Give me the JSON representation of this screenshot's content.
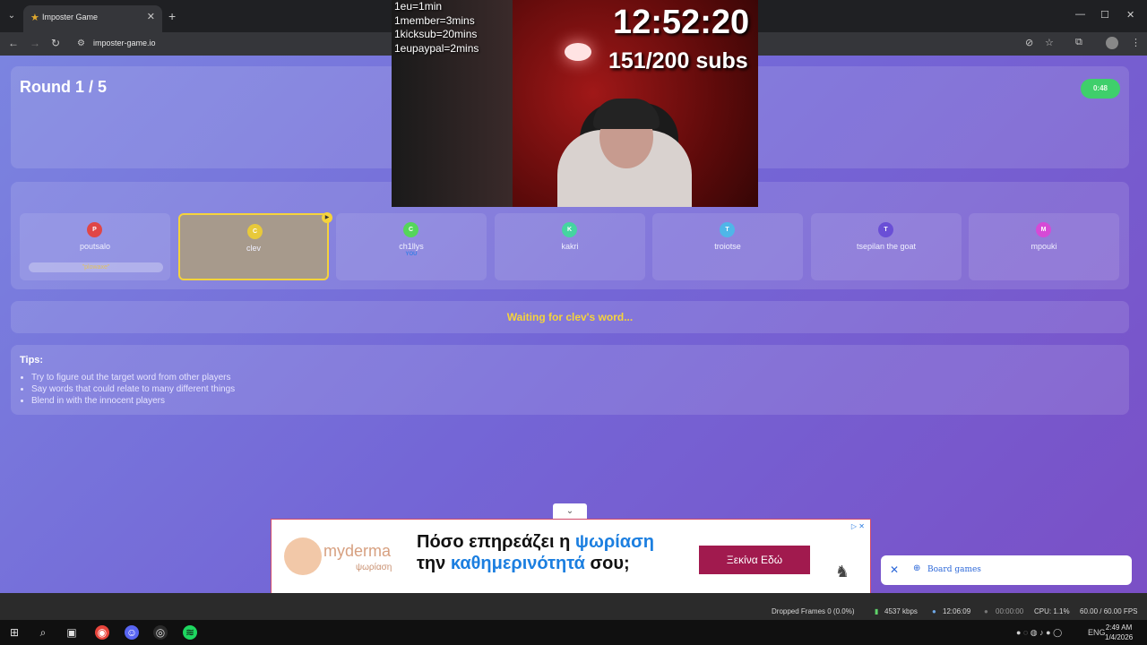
{
  "browser": {
    "tab_title": "Imposter Game",
    "url": "imposter-game.io"
  },
  "game": {
    "round": "Round 1 / 5",
    "timer": "0:48",
    "players": [
      {
        "initial": "P",
        "name": "poutsalo",
        "color": "#e04646",
        "word": "\"plowaxe\"",
        "you": "",
        "active": false
      },
      {
        "initial": "C",
        "name": "clev",
        "color": "#e8c93a",
        "word": "",
        "you": "",
        "active": true
      },
      {
        "initial": "C",
        "name": "ch1llys",
        "color": "#55d65a",
        "word": "",
        "you": "YOU",
        "active": false
      },
      {
        "initial": "K",
        "name": "kakri",
        "color": "#45d4a0",
        "word": "",
        "you": "",
        "active": false
      },
      {
        "initial": "T",
        "name": "troiotse",
        "color": "#4fb6e8",
        "word": "",
        "you": "",
        "active": false
      },
      {
        "initial": "T",
        "name": "tsepilan the goat",
        "color": "#6a4fd6",
        "word": "",
        "you": "",
        "active": false
      },
      {
        "initial": "M",
        "name": "mpouki",
        "color": "#d64ad6",
        "word": "",
        "you": "",
        "active": false
      }
    ],
    "waiting": "Waiting for clev's word...",
    "tips_title": "Tips:",
    "tips": [
      "Try to figure out the target word from other players",
      "Say words that could relate to many different things",
      "Blend in with the innocent players"
    ]
  },
  "overlay": {
    "lines": [
      "1eu=1min",
      "1member=3mins",
      "1kicksub=20mins",
      "1eupaypal=2mins"
    ],
    "clock": "12:52:20",
    "subs": "151/200 subs"
  },
  "ad": {
    "brand": "myderma",
    "brand_sub": "ψωρίαση",
    "line1_a": "Πόσο επηρεάζει η ",
    "line1_b": "ψωρίαση",
    "line2_a": "την ",
    "line2_b": "καθημερινότητά",
    "line2_c": " σου;",
    "cta": "Ξεκίνα Εδώ",
    "accent": "#1c7fe0"
  },
  "snackbar": {
    "label": "Board games"
  },
  "obs": {
    "dropped": "Dropped Frames 0 (0.0%)",
    "kbps": "4537 kbps",
    "rec_time": "12:06:09",
    "stream_time": "00:00:00",
    "cpu": "CPU: 1.1%",
    "fps": "60.00 / 60.00 FPS"
  },
  "taskbar": {
    "lang": "ENG",
    "time": "2:49 AM",
    "date": "1/4/2026"
  }
}
